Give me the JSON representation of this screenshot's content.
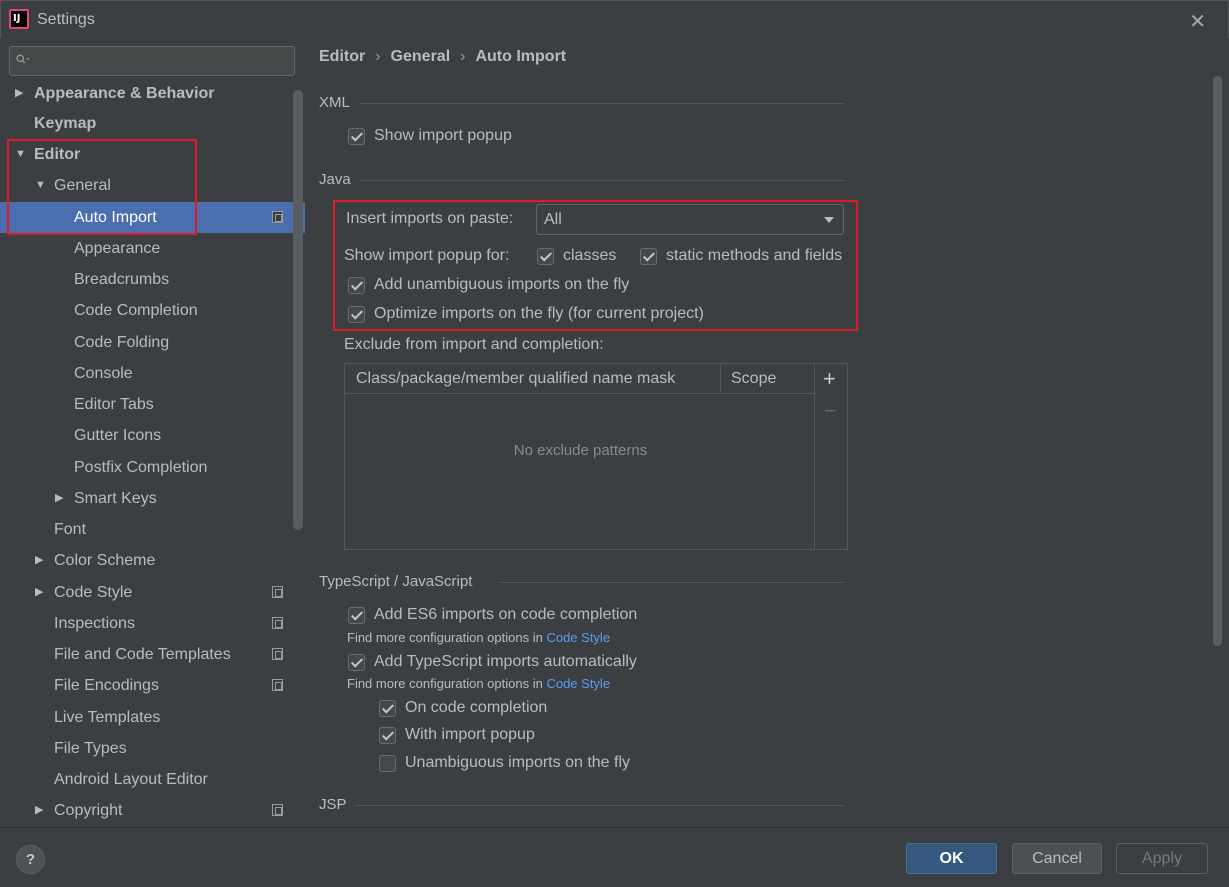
{
  "window": {
    "title": "Settings",
    "logo_text": "IJ"
  },
  "search": {
    "value": "",
    "placeholder": ""
  },
  "sidebar": {
    "items": [
      {
        "label": "Appearance & Behavior"
      },
      {
        "label": "Keymap"
      },
      {
        "label": "Editor"
      },
      {
        "label": "General"
      },
      {
        "label": "Auto Import"
      },
      {
        "label": "Appearance"
      },
      {
        "label": "Breadcrumbs"
      },
      {
        "label": "Code Completion"
      },
      {
        "label": "Code Folding"
      },
      {
        "label": "Console"
      },
      {
        "label": "Editor Tabs"
      },
      {
        "label": "Gutter Icons"
      },
      {
        "label": "Postfix Completion"
      },
      {
        "label": "Smart Keys"
      },
      {
        "label": "Font"
      },
      {
        "label": "Color Scheme"
      },
      {
        "label": "Code Style"
      },
      {
        "label": "Inspections"
      },
      {
        "label": "File and Code Templates"
      },
      {
        "label": "File Encodings"
      },
      {
        "label": "Live Templates"
      },
      {
        "label": "File Types"
      },
      {
        "label": "Android Layout Editor"
      },
      {
        "label": "Copyright"
      }
    ]
  },
  "breadcrumb": {
    "items": [
      "Editor",
      "General",
      "Auto Import"
    ]
  },
  "xml": {
    "title": "XML",
    "show_import_popup": {
      "label": "Show import popup",
      "checked": true
    }
  },
  "java": {
    "title": "Java",
    "insert_imports_label": "Insert imports on paste:",
    "insert_imports_value": "All",
    "show_popup_for_label": "Show import popup for:",
    "classes": {
      "label": "classes",
      "checked": true
    },
    "static_methods": {
      "label": "static methods and fields",
      "checked": true
    },
    "add_unambiguous": {
      "label": "Add unambiguous imports on the fly",
      "checked": true
    },
    "optimize_imports": {
      "label": "Optimize imports on the fly (for current project)",
      "checked": true
    },
    "exclude_label": "Exclude from import and completion:",
    "table": {
      "columns": [
        "Class/package/member qualified name mask",
        "Scope"
      ],
      "empty_text": "No exclude patterns",
      "add_label": "+",
      "remove_label": "−"
    }
  },
  "typescript": {
    "title": "TypeScript / JavaScript",
    "add_es6": {
      "label": "Add ES6 imports on code completion",
      "checked": true
    },
    "hint1_text": "Find more configuration options in ",
    "hint1_link": "Code Style",
    "add_ts": {
      "label": "Add TypeScript imports automatically",
      "checked": true
    },
    "hint2_text": "Find more configuration options in ",
    "hint2_link": "Code Style",
    "on_completion": {
      "label": "On code completion",
      "checked": true
    },
    "with_popup": {
      "label": "With import popup",
      "checked": true
    },
    "unambiguous": {
      "label": "Unambiguous imports on the fly",
      "checked": false
    }
  },
  "jsp": {
    "title": "JSP"
  },
  "footer": {
    "help_label": "?",
    "ok_label": "OK",
    "cancel_label": "Cancel",
    "apply_label": "Apply"
  },
  "colors": {
    "background": "#3c3f41",
    "selection": "#4b6eaf",
    "highlight_box": "#e0182a",
    "link": "#589df6",
    "ok_button": "#365880"
  }
}
